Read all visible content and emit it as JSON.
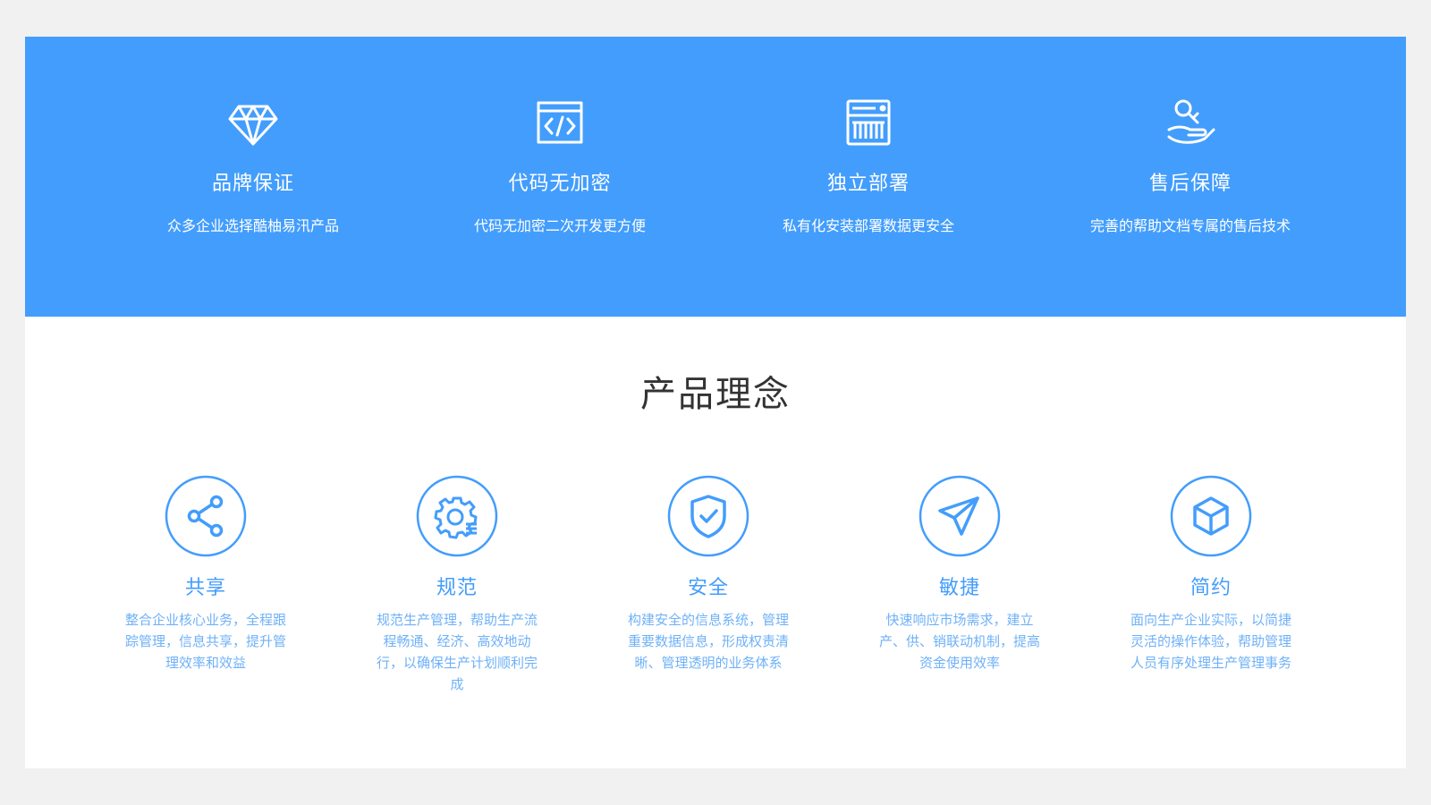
{
  "features": [
    {
      "icon": "diamond-icon",
      "title": "品牌保证",
      "desc": "众多企业选择酷柚易汛产品"
    },
    {
      "icon": "code-window-icon",
      "title": "代码无加密",
      "desc": "代码无加密二次开发更方便"
    },
    {
      "icon": "server-icon",
      "title": "独立部署",
      "desc": "私有化安装部署数据更安全"
    },
    {
      "icon": "hand-service-icon",
      "title": "售后保障",
      "desc": "完善的帮助文档专属的售后技术"
    }
  ],
  "concepts": {
    "title": "产品理念",
    "items": [
      {
        "icon": "share-icon",
        "title": "共享",
        "desc": "整合企业核心业务，全程跟踪管理，信息共享，提升管理效率和效益"
      },
      {
        "icon": "gear-list-icon",
        "title": "规范",
        "desc": "规范生产管理，帮助生产流程畅通、经济、高效地动行，以确保生产计划顺利完成"
      },
      {
        "icon": "shield-check-icon",
        "title": "安全",
        "desc": "构建安全的信息系统，管理重要数据信息，形成权责清晰、管理透明的业务体系"
      },
      {
        "icon": "paper-plane-icon",
        "title": "敏捷",
        "desc": "快速响应市场需求，建立产、供、销联动机制，提高资金使用效率"
      },
      {
        "icon": "cube-icon",
        "title": "简约",
        "desc": "面向生产企业实际，以简捷灵活的操作体验，帮助管理人员有序处理生产管理事务"
      }
    ]
  },
  "colors": {
    "banner": "#439dfc",
    "accent": "#439dfc",
    "background": "#f1f1f1"
  }
}
